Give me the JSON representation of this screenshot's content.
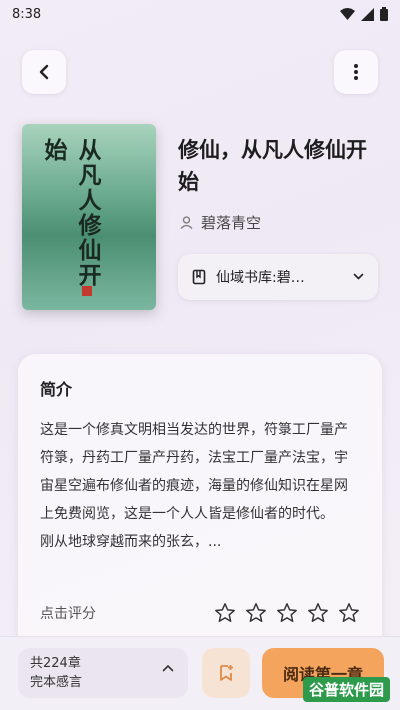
{
  "status": {
    "time": "8:38"
  },
  "nav": {
    "back_icon": "chevron-left-icon",
    "more_icon": "more-vertical-icon"
  },
  "book": {
    "title": "修仙，从凡人修仙开始",
    "author": "碧落青空",
    "cover_title": "从凡人修仙开始",
    "source_label": "仙域书库:碧…"
  },
  "intro": {
    "heading": "简介",
    "text": "这是一个修真文明相当发达的世界，符箓工厂量产符箓，丹药工厂量产丹药，法宝工厂量产法宝，宇宙星空遍布修仙者的痕迹，海量的修仙知识在星网上免费阅览，这是一个人人皆是修仙者的时代。　　刚从地球穿越而来的张玄，...",
    "rating_label": "点击评分",
    "stars": 0
  },
  "bottom": {
    "chapters": "共224章",
    "status": "完本感言",
    "read_label": "阅读第一章"
  },
  "watermark": "谷普软件园",
  "colors": {
    "accent": "#f4a45d",
    "bookmark_bg": "#f7e3d4"
  }
}
